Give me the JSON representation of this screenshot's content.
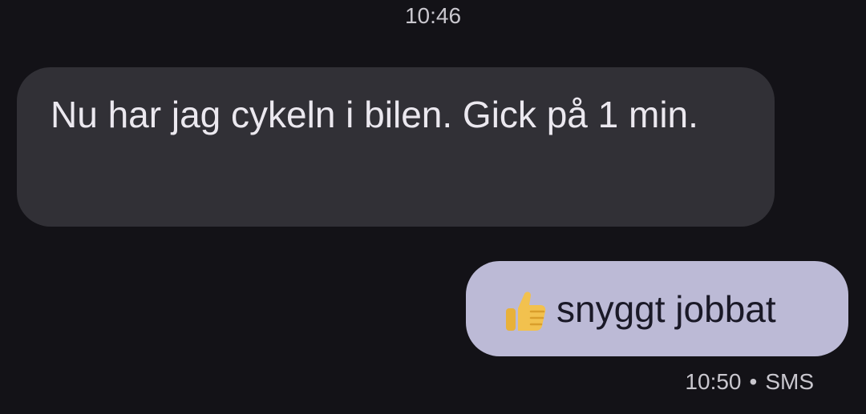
{
  "conversation": {
    "timestamp_header": "10:46",
    "messages": [
      {
        "direction": "incoming",
        "text": "Nu har jag cykeln i bilen. Gick på 1 min."
      },
      {
        "direction": "outgoing",
        "emoji": "thumbs-up-icon",
        "text": "snyggt jobbat",
        "time": "10:50",
        "separator": "•",
        "channel": "SMS"
      }
    ]
  },
  "colors": {
    "background": "#131217",
    "incoming_bubble": "#313036",
    "outgoing_bubble": "#bcbad6",
    "thumbs_up": "#f2c14e"
  }
}
